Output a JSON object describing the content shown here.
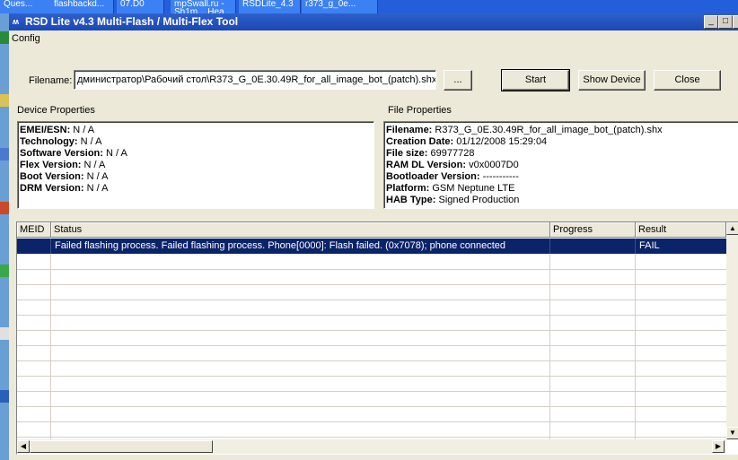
{
  "taskbar": {
    "tasks": [
      {
        "label": "Ques..."
      },
      {
        "label": "flashbackd..."
      },
      {
        "label": "07.D0"
      },
      {
        "label": "mpSwall.ru - Sh1m... Hea..."
      },
      {
        "label": "RSDLite_4.3"
      },
      {
        "label": "r373_g_0e..."
      }
    ]
  },
  "window": {
    "title": "RSD Lite v4.3 Multi-Flash / Multi-Flex Tool",
    "menu": {
      "config": "Config"
    }
  },
  "filename": {
    "label": "Filename:",
    "value": "дминистратор\\Рабочий стол\\R373_G_0E.30.49R_for_all_image_bot_(patch).shx",
    "browse_label": "..."
  },
  "buttons": {
    "start": "Start",
    "show_device": "Show Device",
    "close": "Close"
  },
  "device_properties": {
    "title": "Device Properties",
    "items": [
      {
        "label": "EMEI/ESN:",
        "value": "N / A"
      },
      {
        "label": "Technology:",
        "value": "N / A"
      },
      {
        "label": "Software Version:",
        "value": "N / A"
      },
      {
        "label": "Flex Version:",
        "value": "N / A"
      },
      {
        "label": "Boot Version:",
        "value": "N / A"
      },
      {
        "label": "DRM Version:",
        "value": "N / A"
      }
    ]
  },
  "file_properties": {
    "title": "File Properties",
    "items": [
      {
        "label": "Filename:",
        "value": "R373_G_0E.30.49R_for_all_image_bot_(patch).shx"
      },
      {
        "label": "Creation Date:",
        "value": "01/12/2008 15:29:04"
      },
      {
        "label": "File size:",
        "value": "69977728"
      },
      {
        "label": "RAM DL Version:",
        "value": "v0x0007D0"
      },
      {
        "label": "Bootloader Version:",
        "value": "-----------"
      },
      {
        "label": "Platform:",
        "value": "GSM Neptune LTE"
      },
      {
        "label": "HAB Type:",
        "value": "Signed Production"
      }
    ]
  },
  "grid": {
    "columns": [
      "MEID",
      "Status",
      "Progress",
      "Result"
    ],
    "rows": [
      {
        "meid": "",
        "status": "Failed flashing process. Failed flashing process. Phone[0000]: Flash failed. (0x7078); phone connected",
        "progress": "",
        "result": "FAIL"
      }
    ]
  },
  "colors": {
    "title_bar": "#1a47b8",
    "selection": "#0a246a",
    "face": "#ece9d8"
  }
}
